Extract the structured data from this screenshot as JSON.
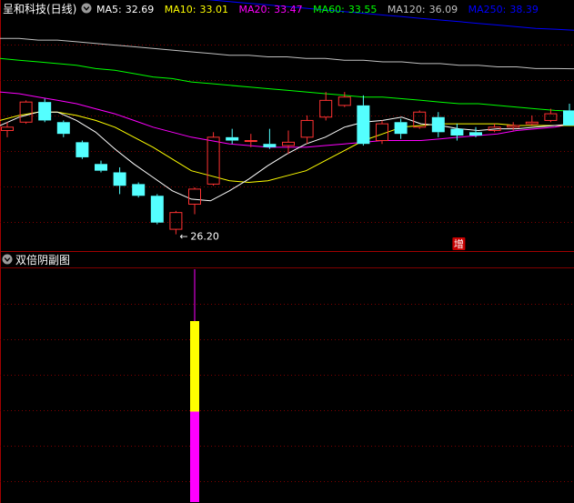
{
  "main": {
    "title": "呈和科技(日线)",
    "ma_legend": [
      {
        "label": "MA5:",
        "value": "32.69",
        "color": "#ffffff"
      },
      {
        "label": "MA10:",
        "value": "33.01",
        "color": "#ffff00"
      },
      {
        "label": "MA20:",
        "value": "33.47",
        "color": "#ff00ff"
      },
      {
        "label": "MA60:",
        "value": "33.55",
        "color": "#00ff00"
      },
      {
        "label": "MA120:",
        "value": "36.09",
        "color": "#c0c0c0"
      },
      {
        "label": "MA250:",
        "value": "38.39",
        "color": "#0000ff"
      }
    ],
    "low_marker": "26.20",
    "badge": "增"
  },
  "sub": {
    "title": "双倍阴副图"
  },
  "colors": {
    "up": "#ff3232",
    "down": "#54ffff",
    "grid": "#800000",
    "border": "#a00000",
    "bar_top": "#ffff00",
    "bar_bottom": "#ff00ff",
    "badge_bg": "#c80000"
  },
  "chart_data": {
    "type": "candlestick",
    "price_range": [
      25.2,
      39.0
    ],
    "candles": [
      {
        "o": 32.4,
        "h": 32.9,
        "l": 32.0,
        "c": 32.6
      },
      {
        "o": 32.9,
        "h": 34.2,
        "l": 32.8,
        "c": 34.1
      },
      {
        "o": 34.1,
        "h": 34.3,
        "l": 32.9,
        "c": 33.0
      },
      {
        "o": 32.9,
        "h": 33.0,
        "l": 32.0,
        "c": 32.2
      },
      {
        "o": 31.7,
        "h": 31.8,
        "l": 30.7,
        "c": 30.8
      },
      {
        "o": 30.4,
        "h": 30.6,
        "l": 29.9,
        "c": 30.0
      },
      {
        "o": 29.9,
        "h": 30.2,
        "l": 28.6,
        "c": 29.1
      },
      {
        "o": 29.2,
        "h": 29.3,
        "l": 28.4,
        "c": 28.5
      },
      {
        "o": 28.5,
        "h": 28.6,
        "l": 26.8,
        "c": 26.9
      },
      {
        "o": 26.5,
        "h": 27.6,
        "l": 26.2,
        "c": 27.5
      },
      {
        "o": 28.0,
        "h": 29.0,
        "l": 27.4,
        "c": 28.9
      },
      {
        "o": 29.2,
        "h": 32.3,
        "l": 29.1,
        "c": 32.0
      },
      {
        "o": 32.0,
        "h": 32.5,
        "l": 31.6,
        "c": 31.8
      },
      {
        "o": 31.8,
        "h": 32.2,
        "l": 31.4,
        "c": 31.8
      },
      {
        "o": 31.6,
        "h": 32.5,
        "l": 31.3,
        "c": 31.4
      },
      {
        "o": 31.5,
        "h": 32.4,
        "l": 31.0,
        "c": 31.7
      },
      {
        "o": 32.0,
        "h": 33.3,
        "l": 31.6,
        "c": 33.0
      },
      {
        "o": 33.2,
        "h": 34.7,
        "l": 33.0,
        "c": 34.2
      },
      {
        "o": 33.9,
        "h": 34.7,
        "l": 33.8,
        "c": 34.4
      },
      {
        "o": 33.9,
        "h": 34.5,
        "l": 31.5,
        "c": 31.6
      },
      {
        "o": 31.8,
        "h": 33.0,
        "l": 31.6,
        "c": 32.8
      },
      {
        "o": 32.9,
        "h": 33.1,
        "l": 31.9,
        "c": 32.2
      },
      {
        "o": 32.6,
        "h": 33.6,
        "l": 32.5,
        "c": 33.5
      },
      {
        "o": 33.2,
        "h": 33.5,
        "l": 32.0,
        "c": 32.3
      },
      {
        "o": 32.5,
        "h": 32.8,
        "l": 31.8,
        "c": 32.1
      },
      {
        "o": 32.3,
        "h": 32.6,
        "l": 32.0,
        "c": 32.1
      },
      {
        "o": 32.4,
        "h": 32.8,
        "l": 32.3,
        "c": 32.6
      },
      {
        "o": 32.6,
        "h": 32.9,
        "l": 32.4,
        "c": 32.7
      },
      {
        "o": 32.8,
        "h": 33.3,
        "l": 32.7,
        "c": 32.9
      },
      {
        "o": 33.0,
        "h": 33.7,
        "l": 32.9,
        "c": 33.4
      },
      {
        "o": 33.6,
        "h": 34.0,
        "l": 32.7,
        "c": 32.7
      }
    ],
    "ma5": [
      32.7,
      33.2,
      33.5,
      33.5,
      33.0,
      32.3,
      31.3,
      30.4,
      29.6,
      28.8,
      28.3,
      28.2,
      28.8,
      29.5,
      30.3,
      31.0,
      31.6,
      32.0,
      32.6,
      32.9,
      33.0,
      33.2,
      32.8,
      32.7,
      32.5,
      32.4,
      32.5,
      32.5,
      32.6,
      32.7,
      32.8
    ],
    "ma10": [
      33.0,
      33.3,
      33.5,
      33.5,
      33.3,
      33.0,
      32.6,
      32.0,
      31.4,
      30.7,
      30.0,
      29.7,
      29.4,
      29.3,
      29.4,
      29.7,
      30.0,
      30.6,
      31.2,
      31.8,
      32.2,
      32.6,
      32.7,
      32.8,
      32.8,
      32.8,
      32.8,
      32.7,
      32.7,
      32.7,
      32.7
    ],
    "ma20": [
      34.7,
      34.6,
      34.4,
      34.2,
      34.0,
      33.7,
      33.4,
      33.0,
      32.6,
      32.3,
      32.0,
      31.8,
      31.6,
      31.5,
      31.4,
      31.4,
      31.4,
      31.5,
      31.6,
      31.7,
      31.8,
      31.8,
      31.8,
      31.9,
      32.0,
      32.1,
      32.2,
      32.4,
      32.5,
      32.6,
      32.8
    ],
    "ma60": [
      36.7,
      36.6,
      36.5,
      36.4,
      36.3,
      36.1,
      36.0,
      35.8,
      35.6,
      35.5,
      35.3,
      35.2,
      35.1,
      35.0,
      34.9,
      34.8,
      34.7,
      34.6,
      34.5,
      34.4,
      34.4,
      34.3,
      34.2,
      34.1,
      34.0,
      34.0,
      33.9,
      33.8,
      33.7,
      33.6,
      33.55
    ],
    "ma120": [
      37.9,
      37.9,
      37.8,
      37.8,
      37.7,
      37.6,
      37.5,
      37.4,
      37.3,
      37.2,
      37.1,
      37.0,
      36.9,
      36.9,
      36.8,
      36.8,
      36.7,
      36.7,
      36.6,
      36.6,
      36.5,
      36.5,
      36.4,
      36.4,
      36.3,
      36.3,
      36.2,
      36.2,
      36.1,
      36.1,
      36.09
    ],
    "ma250": [
      41.2,
      41.1,
      41.0,
      40.9,
      40.9,
      40.8,
      40.7,
      40.6,
      40.5,
      40.4,
      40.3,
      40.2,
      40.1,
      40.0,
      39.9,
      39.8,
      39.7,
      39.6,
      39.5,
      39.4,
      39.3,
      39.2,
      39.1,
      39.0,
      38.9,
      38.8,
      38.7,
      38.6,
      38.5,
      38.45,
      38.39
    ],
    "low_index": 9,
    "badge_index": 24,
    "sub_bar": {
      "index": 10,
      "top_value": 1.0,
      "split_value": 0.5,
      "bottom_value": 0.0
    }
  }
}
